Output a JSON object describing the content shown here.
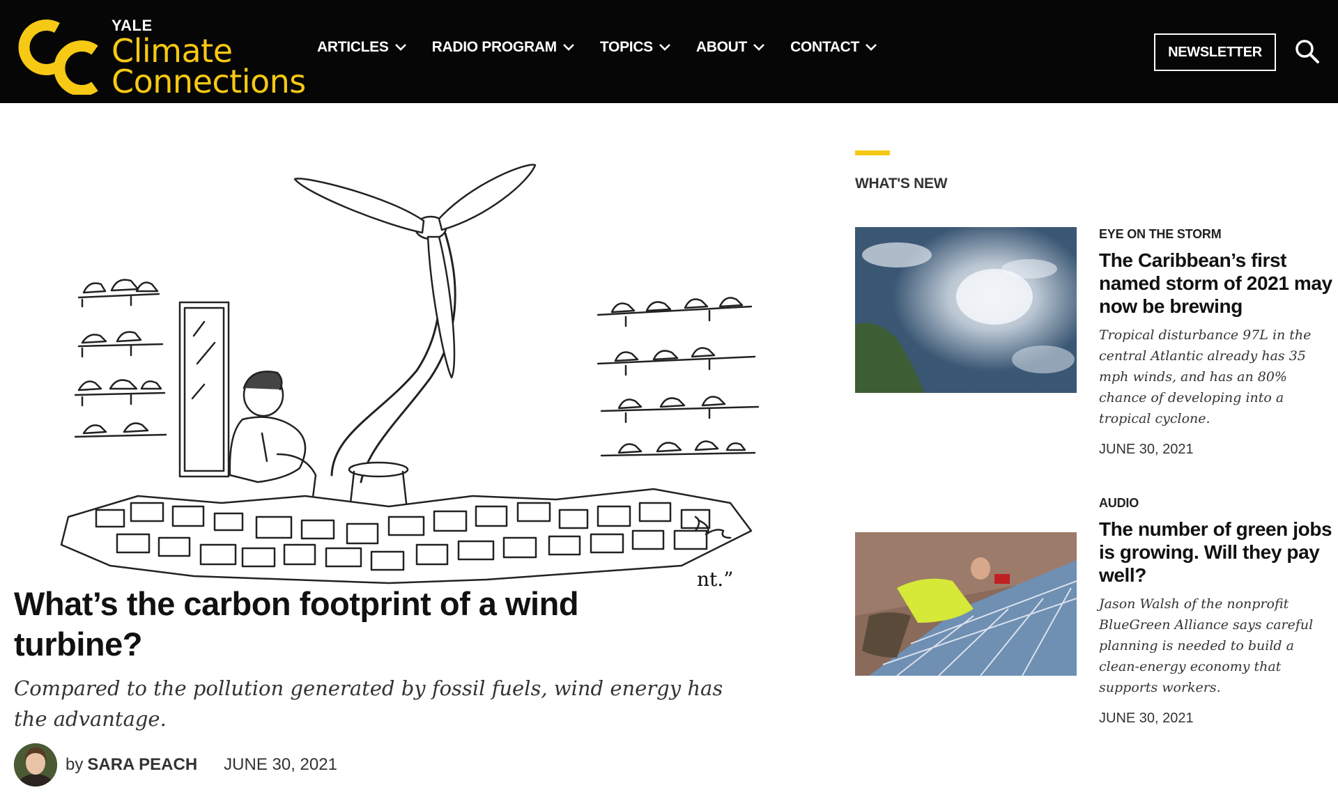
{
  "site": {
    "yale": "YALE",
    "name_line1": "Climate",
    "name_line2": "Connections",
    "brand_yellow": "#f6c914",
    "header_bg": "#060606"
  },
  "nav": {
    "items": [
      {
        "label": "ARTICLES",
        "icon": "chevron-down-icon"
      },
      {
        "label": "RADIO PROGRAM",
        "icon": "chevron-down-icon"
      },
      {
        "label": "TOPICS",
        "icon": "chevron-down-icon"
      },
      {
        "label": "ABOUT",
        "icon": "chevron-down-icon"
      },
      {
        "label": "CONTACT",
        "icon": "chevron-down-icon"
      }
    ],
    "newsletter_label": "NEWSLETTER",
    "search_icon": "search-icon"
  },
  "article": {
    "caption_fragment": "nt.”",
    "headline": "What’s the carbon footprint of a wind turbine?",
    "dek": "Compared to the pollution generated by fossil fuels, wind energy has the advantage.",
    "by": "by",
    "author": "SARA PEACH",
    "date": "JUNE 30, 2021"
  },
  "sidebar": {
    "title": "WHAT'S NEW",
    "cards": [
      {
        "kicker": "EYE ON THE STORM",
        "title": "The Caribbean’s first named storm of 2021 may now be brewing",
        "desc": "Tropical disturbance 97L in the central Atlantic already has 35 mph winds, and has an 80% chance of developing into a tropical cyclone.",
        "date": "JUNE 30, 2021"
      },
      {
        "kicker": "AUDIO",
        "title": "The number of green jobs is growing. Will they pay well?",
        "desc": "Jason Walsh of the nonprofit BlueGreen Alliance says careful planning is needed to build a clean-energy economy that supports workers.",
        "date": "JUNE 30, 2021"
      }
    ]
  }
}
